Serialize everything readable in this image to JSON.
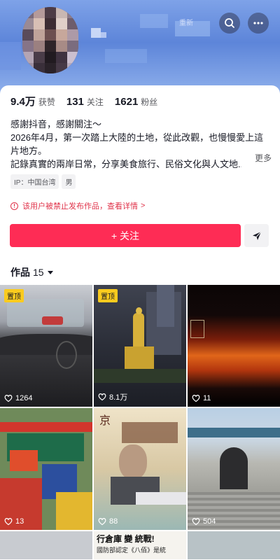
{
  "header": {
    "search_icon": "search-icon",
    "more_icon": "more-icon",
    "badge": "重新"
  },
  "stats": [
    {
      "value": "9.4万",
      "label": "获赞"
    },
    {
      "value": "131",
      "label": "关注"
    },
    {
      "value": "1621",
      "label": "粉丝"
    }
  ],
  "bio": {
    "line1": "感謝抖音，感謝關注～",
    "line2": "2026年4月，第一次踏上大陸的土地，從此改觀，也慢慢愛上這",
    "line3": "片地方。",
    "line4": "記錄真實的兩岸日常，分享美食旅行、民俗文化與人文地...",
    "more": "更多"
  },
  "tags": [
    "IP：中国台湾",
    "男"
  ],
  "warning": {
    "text": "该用户被禁止发布作品，查看详情",
    "chevron": ">"
  },
  "actions": {
    "follow": "+ 关注"
  },
  "works": {
    "label": "作品",
    "count": "15"
  },
  "colors": {
    "accent": "#fe2c55",
    "warning": "#e0334a",
    "pin": "#facb1e"
  },
  "grid": [
    {
      "pinned": "置顶",
      "likes": "1264"
    },
    {
      "pinned": "置顶",
      "likes": "8.1万"
    },
    {
      "pinned": "",
      "likes": "11"
    },
    {
      "pinned": "",
      "likes": "13"
    },
    {
      "pinned": "",
      "likes": "88"
    },
    {
      "pinned": "",
      "likes": "504"
    }
  ],
  "thumb_text": {
    "jing": "京",
    "banner_line1": "行倉庫 變 統戰!",
    "banner_line2": "國防部認定《八佰》是統"
  }
}
